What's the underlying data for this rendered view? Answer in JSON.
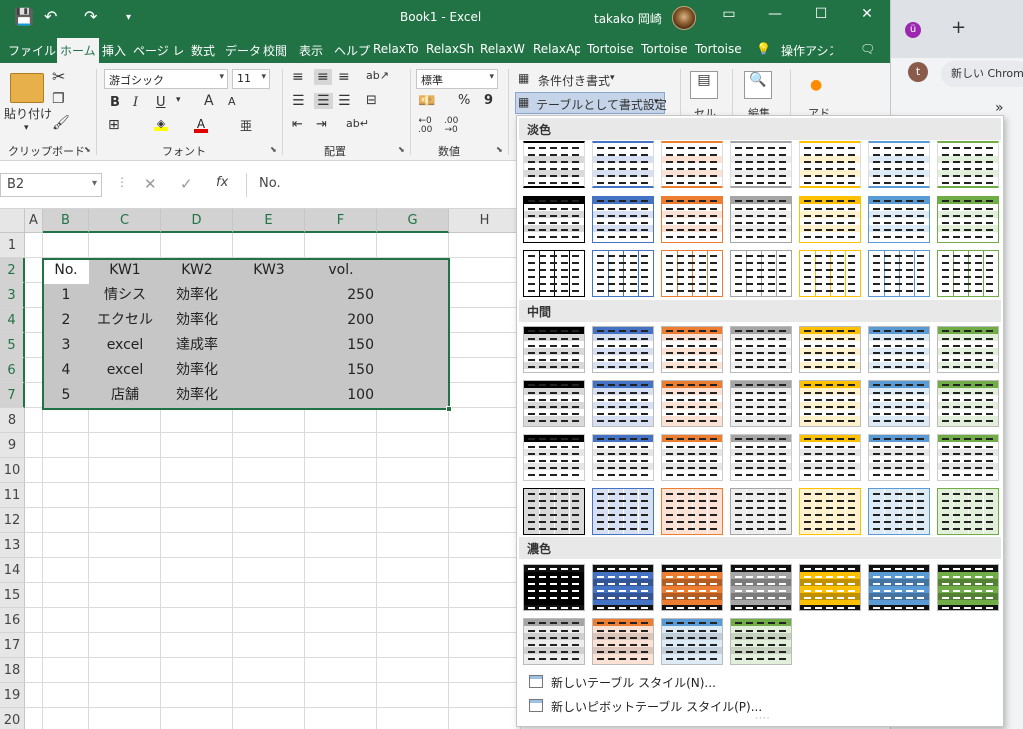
{
  "titlebar": {
    "title": "Book1  -  Excel",
    "user": "takako 岡崎",
    "qa_save": "💾",
    "qa_undo": "↶",
    "qa_redo": "↷",
    "qa_more": "▾",
    "ribbon_display": "▭",
    "minimize": "—",
    "maximize": "☐",
    "close": "✕"
  },
  "tabs": [
    {
      "label": "ファイル"
    },
    {
      "label": "ホーム"
    },
    {
      "label": "挿入"
    },
    {
      "label": "ページ レ"
    },
    {
      "label": "数式"
    },
    {
      "label": "データ"
    },
    {
      "label": "校閲"
    },
    {
      "label": "表示"
    },
    {
      "label": "ヘルプ"
    },
    {
      "label": "RelaxTo"
    },
    {
      "label": "RelaxSh"
    },
    {
      "label": "RelaxW"
    },
    {
      "label": "RelaxAp"
    },
    {
      "label": "Tortoise"
    },
    {
      "label": "Tortoise"
    },
    {
      "label": "Tortoise"
    },
    {
      "label": "操作アシス"
    }
  ],
  "tell_me_icon": "💡",
  "comment_icon": "🗨",
  "ribbon": {
    "clipboard": {
      "paste": "貼り付け",
      "label": "クリップボード"
    },
    "font": {
      "name": "游ゴシック",
      "size": "11",
      "label": "フォント",
      "bold": "B",
      "italic": "I",
      "underline": "U"
    },
    "alignment": {
      "label": "配置"
    },
    "number": {
      "format": "標準",
      "label": "数値",
      "percent": "%",
      "comma": "9"
    },
    "styles": {
      "conditional": "条件付き書式",
      "format_table": "テーブルとして書式設定"
    },
    "cells": {
      "label": "セル"
    },
    "editing": {
      "label": "編集"
    },
    "addins": {
      "label": "アド"
    }
  },
  "formula_bar": {
    "name_box": "B2",
    "cancel": "✕",
    "enter": "✓",
    "fx": "fx",
    "value": "No."
  },
  "columns": [
    "A",
    "B",
    "C",
    "D",
    "E",
    "F",
    "G",
    "H"
  ],
  "rows": [
    "1",
    "2",
    "3",
    "4",
    "5",
    "6",
    "7",
    "8",
    "9",
    "10",
    "11",
    "12",
    "13",
    "14",
    "15",
    "16",
    "17",
    "18",
    "19",
    "20"
  ],
  "table": {
    "headers": [
      "No.",
      "KW1",
      "KW2",
      "KW3",
      "vol."
    ],
    "rows": [
      [
        "1",
        "情シス",
        "効率化",
        "",
        "250"
      ],
      [
        "2",
        "エクセル",
        "効率化",
        "",
        "200"
      ],
      [
        "3",
        "excel",
        "達成率",
        "",
        "150"
      ],
      [
        "4",
        "excel",
        "効率化",
        "",
        "150"
      ],
      [
        "5",
        "店舗",
        "効率化",
        "",
        "100"
      ]
    ]
  },
  "gallery": {
    "light_label": "淡色",
    "medium_label": "中間",
    "dark_label": "濃色",
    "new_table_style": "新しいテーブル スタイル(N)...",
    "new_pivot_style": "新しいピボットテーブル スタイル(P)...",
    "palette": [
      "#000000",
      "#4472c4",
      "#ed7d31",
      "#a5a5a5",
      "#ffc000",
      "#5b9bd5",
      "#70ad47"
    ],
    "palette_light": [
      "#d9d9d9",
      "#d6e0f2",
      "#fbe2d5",
      "#ededed",
      "#fff2cc",
      "#ddebf7",
      "#e2efda"
    ]
  },
  "chrome": {
    "ext": "ü",
    "plus": "+",
    "avatar": "t",
    "new_tab": "新しい Chrome",
    "chevron": "»"
  }
}
